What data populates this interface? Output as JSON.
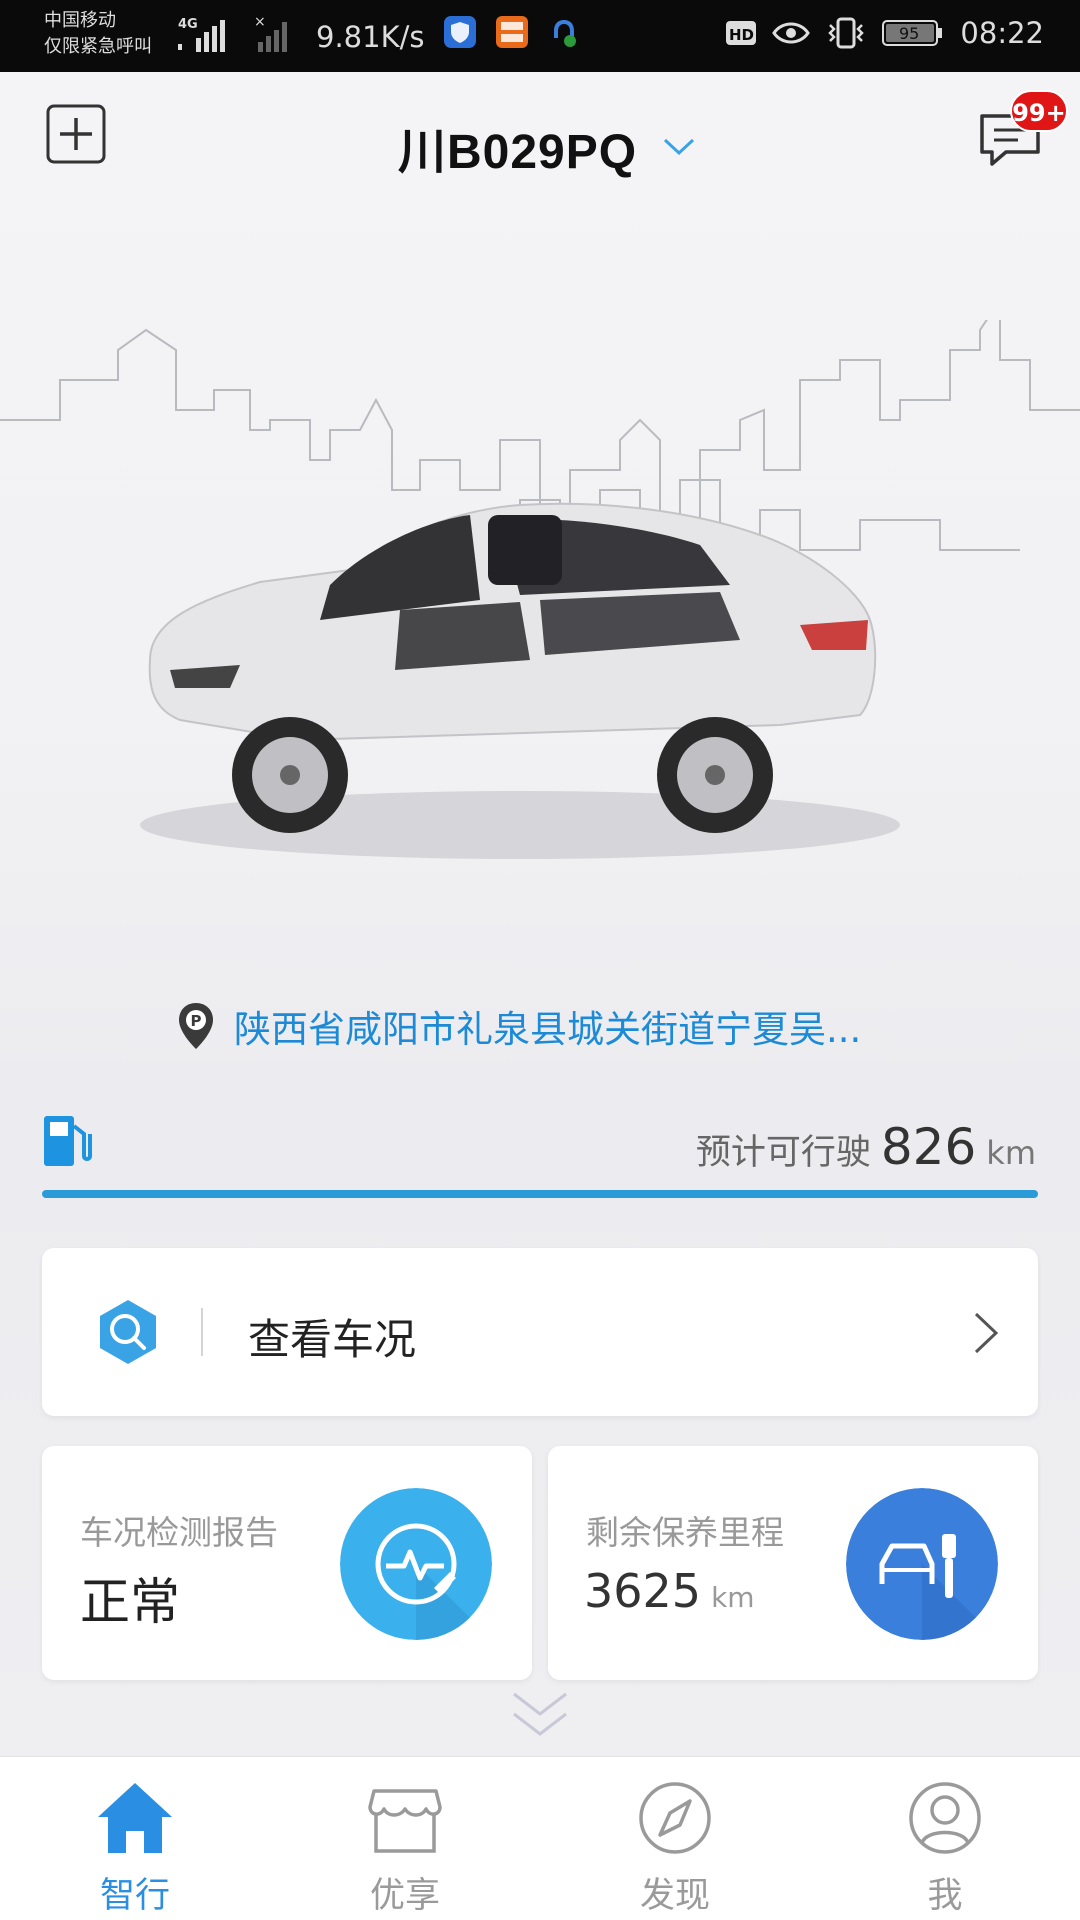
{
  "status_bar": {
    "carrier": "中国移动",
    "carrier_note": "仅限紧急呼叫",
    "network": "4G",
    "speed": "9.81K/s",
    "hd": "HD",
    "battery": "95",
    "time": "08:22"
  },
  "header": {
    "plate": "川B029PQ",
    "message_badge": "99+"
  },
  "location": {
    "address": "陕西省咸阳市礼泉县城关街道宁夏吴..."
  },
  "fuel": {
    "range_label": "预计可行驶",
    "range_value": "826",
    "range_unit": "km",
    "fill_fraction": 1.0
  },
  "status_card": {
    "label": "查看车况"
  },
  "report_card": {
    "title": "车况检测报告",
    "value": "正常"
  },
  "maintenance_card": {
    "title": "剩余保养里程",
    "value": "3625",
    "unit": "km"
  },
  "tabs": [
    {
      "label": "智行",
      "icon": "home-icon",
      "active": true
    },
    {
      "label": "优享",
      "icon": "store-icon",
      "active": false
    },
    {
      "label": "发现",
      "icon": "compass-icon",
      "active": false
    },
    {
      "label": "我",
      "icon": "user-icon",
      "active": false
    }
  ],
  "colors": {
    "accent": "#2a8fe3",
    "link": "#1c8ad6",
    "badge": "#e01515",
    "report_icon_bg": "#3ab0ec",
    "maintenance_icon_bg": "#3a7fdc"
  }
}
